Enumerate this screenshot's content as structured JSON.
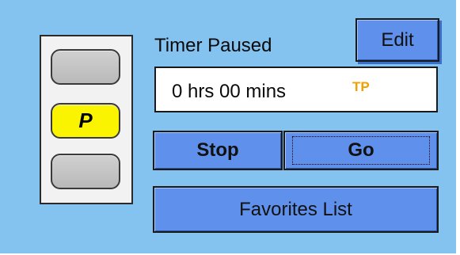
{
  "status": {
    "label": "Timer Paused",
    "indicator_letter": "P",
    "indicator_active": "middle",
    "indicator_color": "#fbf400"
  },
  "display": {
    "time": "0 hrs 00 mins",
    "code": "TP",
    "code_color": "#f0a000"
  },
  "buttons": {
    "edit": "Edit",
    "stop": "Stop",
    "go": "Go",
    "favorites": "Favorites List",
    "color": "#5f90ec"
  },
  "colors": {
    "panel": "#84c2f0"
  }
}
